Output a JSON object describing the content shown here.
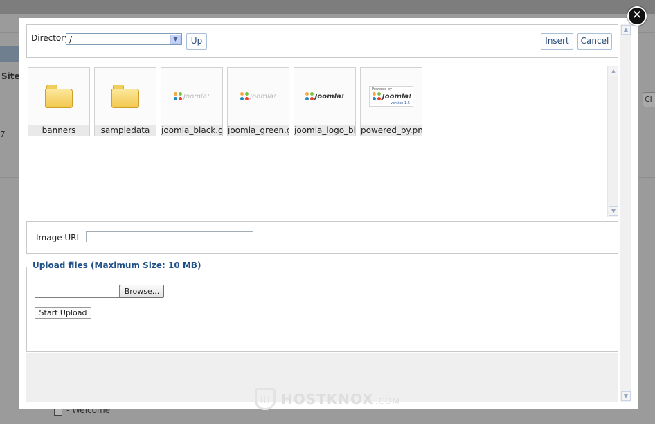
{
  "background": {
    "site_label": "Site",
    "number_label": "7",
    "right_button_label": "Cl",
    "welcome_label": "- Welcome"
  },
  "modal": {
    "close_icon": "close-icon",
    "directory": {
      "label": "Directory",
      "selected": "/",
      "up_label": "Up"
    },
    "actions": {
      "insert_label": "Insert",
      "cancel_label": "Cancel"
    },
    "files": [
      {
        "name": "banners",
        "type": "folder",
        "icon": "folder-icon"
      },
      {
        "name": "sampledata",
        "type": "folder",
        "icon": "folder-icon"
      },
      {
        "name": "joomla_black.gif",
        "type": "image",
        "icon": "joomla-logo-thumbnail"
      },
      {
        "name": "joomla_green.gif",
        "type": "image",
        "icon": "joomla-logo-thumbnail"
      },
      {
        "name": "joomla_logo_bla",
        "type": "image",
        "icon": "joomla-logo-thumbnail"
      },
      {
        "name": "powered_by.png",
        "type": "image",
        "icon": "powered-by-thumbnail"
      }
    ],
    "thumb_text": {
      "logo_word": "Joomla!",
      "powered_small": "Powered by",
      "version_small": "version 1.5"
    },
    "image_url": {
      "label": "Image URL",
      "value": ""
    },
    "upload": {
      "legend": "Upload files (Maximum Size: 10 MB)",
      "browse_label": "Browse...",
      "start_label": "Start Upload"
    }
  },
  "watermark": {
    "text": "HOSTKNOX",
    "suffix": ".COM"
  }
}
